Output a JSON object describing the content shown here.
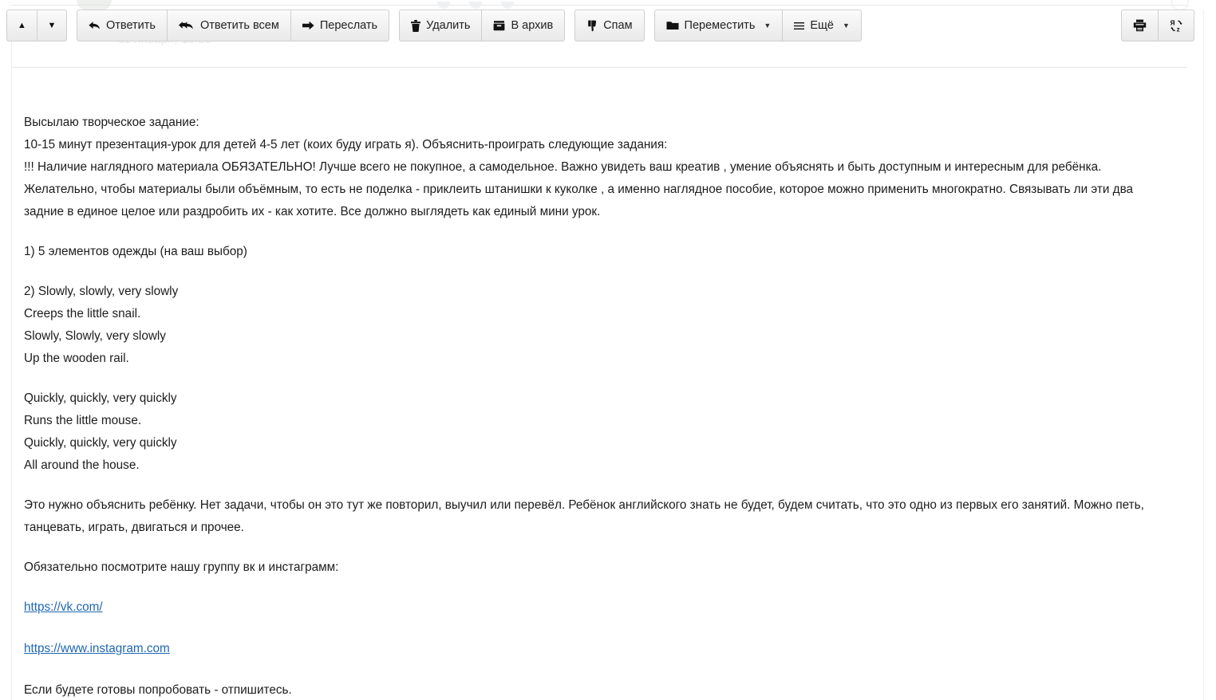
{
  "window": {
    "ghost_date": "11 января, 13:23"
  },
  "toolbar": {
    "nav": {
      "prev_label": "▲",
      "next_label": "▼",
      "prev_icon": "triangle-up-icon",
      "next_icon": "triangle-down-icon"
    },
    "actions": [
      {
        "label": "Ответить",
        "icon": "reply-arrow-icon",
        "caret": ""
      },
      {
        "label": "Ответить всем",
        "icon": "reply-all-arrow-icon",
        "caret": ""
      },
      {
        "label": "Переслать",
        "icon": "forward-arrow-icon",
        "caret": ""
      }
    ],
    "manage": [
      {
        "label": "Удалить",
        "icon": "trash-icon"
      },
      {
        "label": "В архив",
        "icon": "archive-box-icon"
      }
    ],
    "spam": {
      "label": "Спам",
      "icon": "thumbs-down-icon"
    },
    "move": {
      "label": "Переместить",
      "icon": "folder-icon",
      "caret": "▼"
    },
    "more": {
      "label": "Ещё",
      "icon": "hamburger-icon",
      "caret": "▼"
    },
    "right_icons": [
      {
        "name": "print-icon",
        "title": "Печать"
      },
      {
        "name": "translate-icon",
        "title": "Перевести"
      }
    ]
  },
  "message": {
    "paragraphs": [
      "Высылаю творческое задание:\n10-15 минут презентация-урок для детей 4-5 лет (коих буду играть я). Объяснить-проиграть следующие задания:\n!!! Наличие наглядного материала ОБЯЗАТЕЛЬНО! Лучше всего не покупное, а самодельное. Важно увидеть ваш креатив , умение объяснять и быть доступным и интересным для ребёнка. Желательно, чтобы материалы были объёмным, то есть не поделка - приклеить штанишки к куколке , а именно наглядное пособие, которое можно применить многократно. Связывать ли эти два задние в единое целое или раздробить их - как хотите. Все должно выглядеть как единый мини урок.",
      "1) 5 элементов одежды (на ваш выбор)",
      "2) Slowly, slowly, very slowly\nCreeps the little snail.\nSlowly, Slowly, very slowly\nUp the wooden rail.",
      "Quickly, quickly, very quickly\nRuns the little mouse.\nQuickly, quickly, very quickly\nAll around the house.",
      "Это нужно объяснить ребёнку. Нет задачи, чтобы он это тут же повторил, выучил или перевёл. Ребёнок английского знать не будет, будем считать, что это одно из первых его занятий. Можно петь, танцевать, играть, двигаться и прочее.",
      "Обязательно посмотрите нашу группу вк и инстаграмм:"
    ],
    "links": [
      {
        "text": "https://vk.com/"
      },
      {
        "text": "https://www.instagram.com"
      }
    ],
    "closing": "Если будете готовы попробовать  - отпишитесь."
  },
  "colors": {
    "link": "#2067b3",
    "text": "#1c1c1c",
    "button_face": "#f2f2f2",
    "button_border": "#cfcfcf",
    "divider": "#e6e6e6"
  }
}
